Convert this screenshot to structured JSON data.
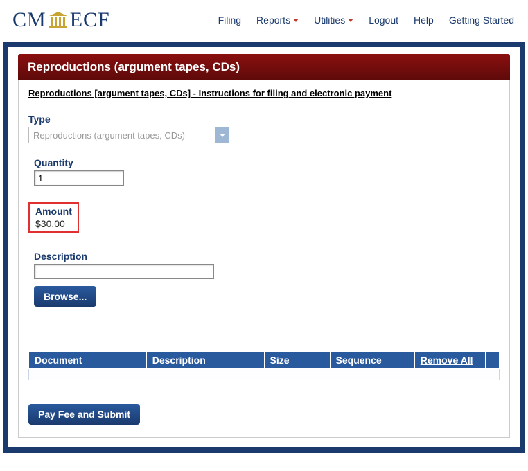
{
  "logo": {
    "cm": "CM",
    "ecf": "ECF"
  },
  "nav": {
    "filing": "Filing",
    "reports": "Reports",
    "utilities": "Utilities",
    "logout": "Logout",
    "help": "Help",
    "getting_started": "Getting Started"
  },
  "panel": {
    "title": "Reproductions (argument tapes, CDs)",
    "instructions_link": "Reproductions [argument tapes, CDs] - Instructions for filing and electronic payment"
  },
  "form": {
    "type_label": "Type",
    "type_value": "Reproductions (argument tapes, CDs)",
    "quantity_label": "Quantity",
    "quantity_value": "1",
    "amount_label": "Amount",
    "amount_value": "$30.00",
    "description_label": "Description",
    "description_value": "",
    "browse_btn": "Browse...",
    "submit_btn": "Pay Fee and Submit"
  },
  "table": {
    "headers": {
      "document": "Document",
      "description": "Description",
      "size": "Size",
      "sequence": "Sequence",
      "remove_all": "Remove All"
    }
  }
}
